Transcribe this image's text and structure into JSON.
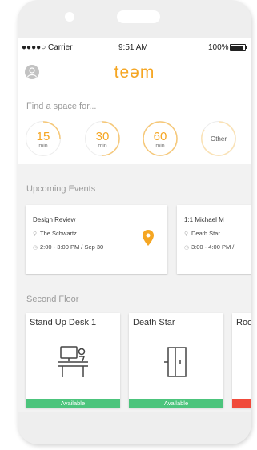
{
  "status_bar": {
    "carrier": "●●●●○ Carrier",
    "time": "9:51 AM",
    "battery": "100%"
  },
  "header": {
    "logo": "teəm",
    "avatar_icon": "user-icon"
  },
  "find_space": {
    "label": "Find a space for...",
    "options": [
      {
        "value": "15",
        "unit": "min"
      },
      {
        "value": "30",
        "unit": "min"
      },
      {
        "value": "60",
        "unit": "min"
      },
      {
        "value": "Other"
      }
    ]
  },
  "upcoming": {
    "label": "Upcoming Events",
    "events": [
      {
        "title": "Design Review",
        "location": "The Schwartz",
        "when": "2:00 - 3:00 PM / Sep 30"
      },
      {
        "title": "1:1 Michael M",
        "location": "Death Star",
        "when": "3:00 - 4:00 PM /"
      }
    ]
  },
  "floor": {
    "label": "Second Floor",
    "rooms": [
      {
        "name": "Stand Up Desk 1",
        "status": "Available",
        "status_color": "#4cc47c",
        "icon": "standing-desk-icon"
      },
      {
        "name": "Death Star",
        "status": "Available",
        "status_color": "#4cc47c",
        "icon": "door-icon"
      },
      {
        "name": "Roo",
        "status": "",
        "status_color": "#f04a3a"
      }
    ]
  },
  "colors": {
    "accent": "#f5a623",
    "available": "#4cc47c",
    "busy": "#f04a3a"
  }
}
